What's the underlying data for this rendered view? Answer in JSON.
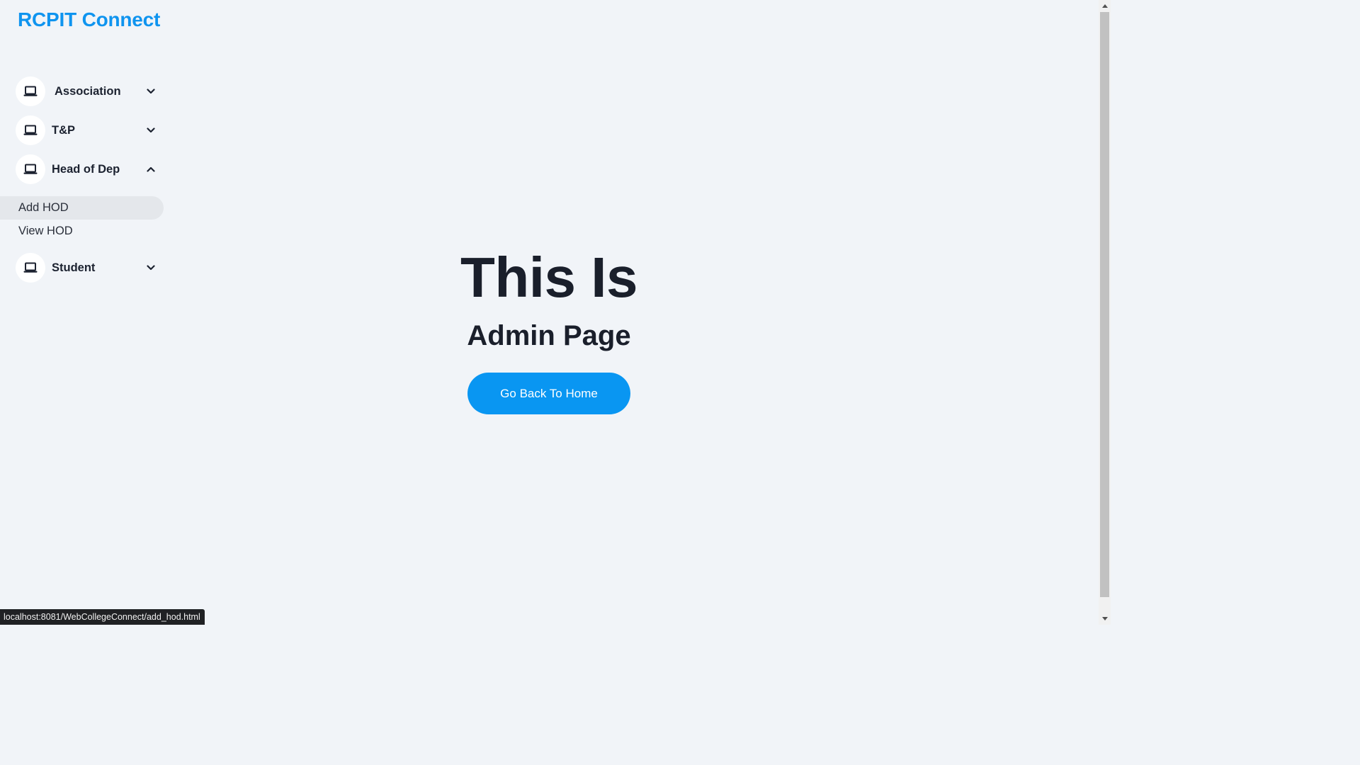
{
  "brand": {
    "title": "RCPIT Connect",
    "color": "#0f94ef"
  },
  "sidebar": {
    "items": [
      {
        "label": "Association",
        "icon": "laptop-icon",
        "expanded": false
      },
      {
        "label": "T&P",
        "icon": "laptop-icon",
        "expanded": false
      },
      {
        "label": "Head of Dep",
        "icon": "laptop-icon",
        "expanded": true,
        "children": [
          {
            "label": "Add HOD",
            "active": true
          },
          {
            "label": "View HOD",
            "active": false
          }
        ]
      },
      {
        "label": "Student",
        "icon": "laptop-icon",
        "expanded": false
      }
    ]
  },
  "main": {
    "title": "This Is",
    "subtitle": "Admin Page",
    "button_label": "Go Back To Home",
    "button_color": "#0996f2"
  },
  "status_bar": {
    "url": "localhost:8081/WebCollegeConnect/add_hod.html"
  }
}
